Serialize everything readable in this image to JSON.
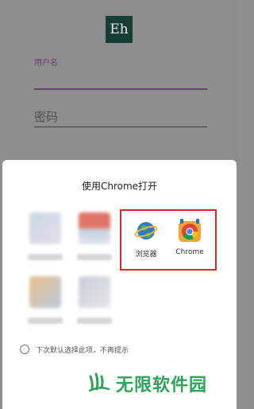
{
  "background_app": {
    "logo_text": "Eh",
    "username_label": "用户名",
    "password_placeholder": "密码"
  },
  "chooser": {
    "title": "使用Chrome打开",
    "apps": [
      {
        "label": "浏览器",
        "icon": "globe-planet-icon"
      },
      {
        "label": "Chrome",
        "icon": "chrome-icon"
      }
    ],
    "blurred_apps": [
      {
        "color_a": "#c9d6e6",
        "color_b": "#e6dfe8"
      },
      {
        "color_a": "#e07268",
        "color_b": "#c6d2de"
      },
      {
        "color_a": "#e9c08d",
        "color_b": "#b8c9da"
      },
      {
        "color_a": "#c9cfd6",
        "color_b": "#e3e6ea"
      }
    ],
    "remember_choice_text": "下次默认选择此项，不再提示",
    "highlight_color": "#e0262a"
  },
  "watermark": {
    "text": "无限软件园",
    "color": "#2fa35a"
  }
}
